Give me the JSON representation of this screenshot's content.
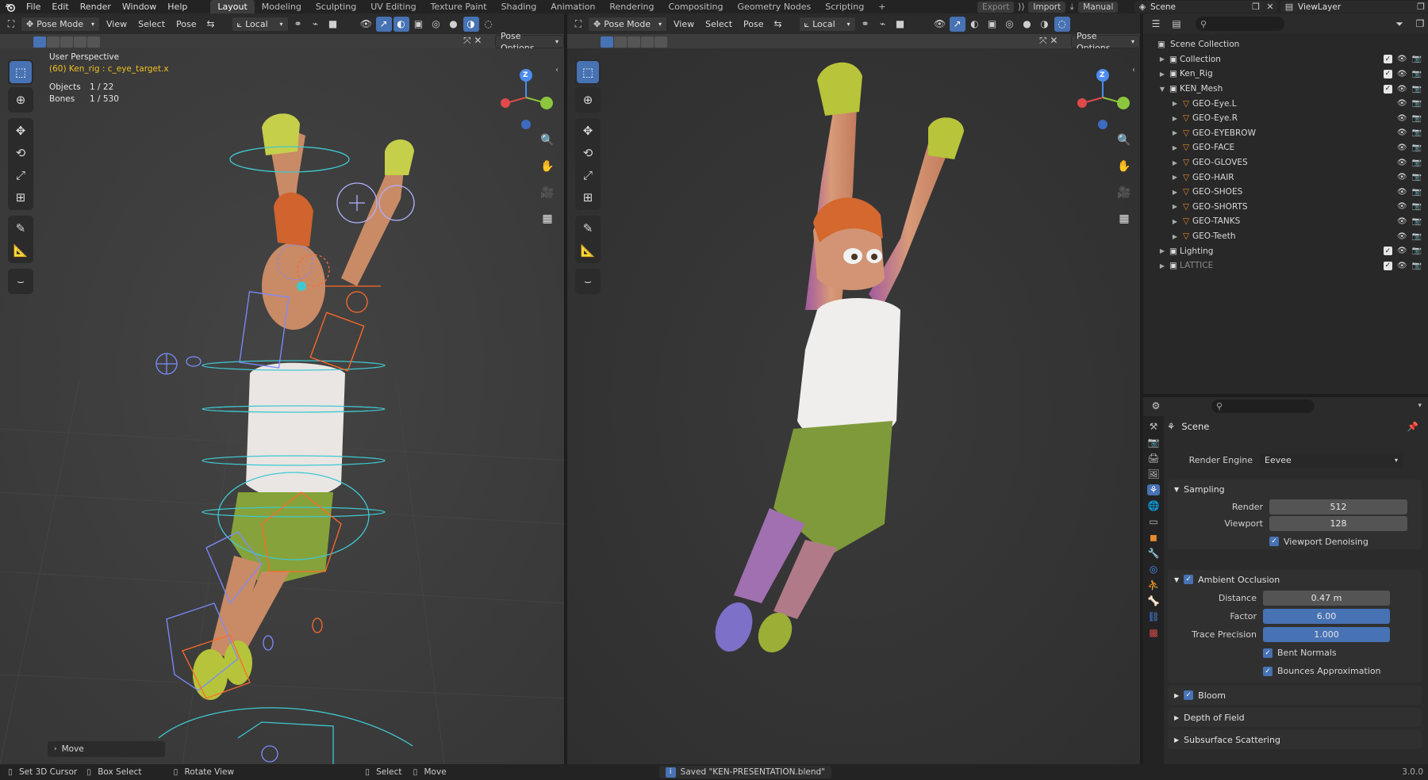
{
  "menu": [
    "File",
    "Edit",
    "Render",
    "Window",
    "Help"
  ],
  "workspaces": [
    "Layout",
    "Modeling",
    "Sculpting",
    "UV Editing",
    "Texture Paint",
    "Shading",
    "Animation",
    "Rendering",
    "Compositing",
    "Geometry Nodes",
    "Scripting"
  ],
  "workspace_add": "+",
  "topright": {
    "export": "Export",
    "import": "Import",
    "manual": "Manual",
    "scene": "Scene",
    "viewlayer": "ViewLayer"
  },
  "left_view": {
    "mode": "Pose Mode",
    "view": "View",
    "select": "Select",
    "pose": "Pose",
    "orientation": "Local",
    "pose_options": "Pose Options",
    "overlay_title": "User Perspective",
    "overlay_active": "(60) Ken_rig : c_eye_target.x",
    "objects_label": "Objects",
    "objects_value": "1 / 22",
    "bones_label": "Bones",
    "bones_value": "1 / 530",
    "gizmo_z": "Z",
    "last_op": "Move"
  },
  "right_view": {
    "mode": "Pose Mode",
    "view": "View",
    "select": "Select",
    "pose": "Pose",
    "orientation": "Local",
    "pose_options": "Pose Options",
    "gizmo_z": "Z"
  },
  "outliner": {
    "root": "Scene Collection",
    "items": [
      {
        "name": "Collection",
        "depth": 1,
        "open": false
      },
      {
        "name": "Ken_Rig",
        "depth": 1,
        "open": false
      },
      {
        "name": "KEN_Mesh",
        "depth": 1,
        "open": true
      },
      {
        "name": "GEO-Eye.L",
        "depth": 2
      },
      {
        "name": "GEO-Eye.R",
        "depth": 2
      },
      {
        "name": "GEO-EYEBROW",
        "depth": 2
      },
      {
        "name": "GEO-FACE",
        "depth": 2
      },
      {
        "name": "GEO-GLOVES",
        "depth": 2
      },
      {
        "name": "GEO-HAIR",
        "depth": 2
      },
      {
        "name": "GEO-SHOES",
        "depth": 2
      },
      {
        "name": "GEO-SHORTS",
        "depth": 2
      },
      {
        "name": "GEO-TANKS",
        "depth": 2
      },
      {
        "name": "GEO-Teeth",
        "depth": 2
      },
      {
        "name": "Lighting",
        "depth": 1,
        "open": false
      },
      {
        "name": "LATTICE",
        "depth": 1,
        "open": false
      }
    ]
  },
  "properties": {
    "context": "Scene",
    "render_engine_label": "Render Engine",
    "render_engine": "Eevee",
    "sampling": {
      "title": "Sampling",
      "render_label": "Render",
      "render": "512",
      "viewport_label": "Viewport",
      "viewport": "128",
      "denoise": "Viewport Denoising"
    },
    "ao": {
      "title": "Ambient Occlusion",
      "distance_label": "Distance",
      "distance": "0.47 m",
      "factor_label": "Factor",
      "factor": "6.00",
      "trace_label": "Trace Precision",
      "trace": "1.000",
      "bent": "Bent Normals",
      "bounces": "Bounces Approximation"
    },
    "bloom": "Bloom",
    "dof": "Depth of Field",
    "sss": "Subsurface Scattering"
  },
  "status": {
    "cursor": "Set 3D Cursor",
    "box": "Box Select",
    "rotate": "Rotate View",
    "select": "Select",
    "move": "Move",
    "saved": "Saved \"KEN-PRESENTATION.blend\"",
    "version": "3.0.0"
  },
  "colors": {
    "accent": "#4772b3",
    "viewport": "#3d3d3d",
    "header": "#2b2b2b",
    "panel": "#303030"
  }
}
